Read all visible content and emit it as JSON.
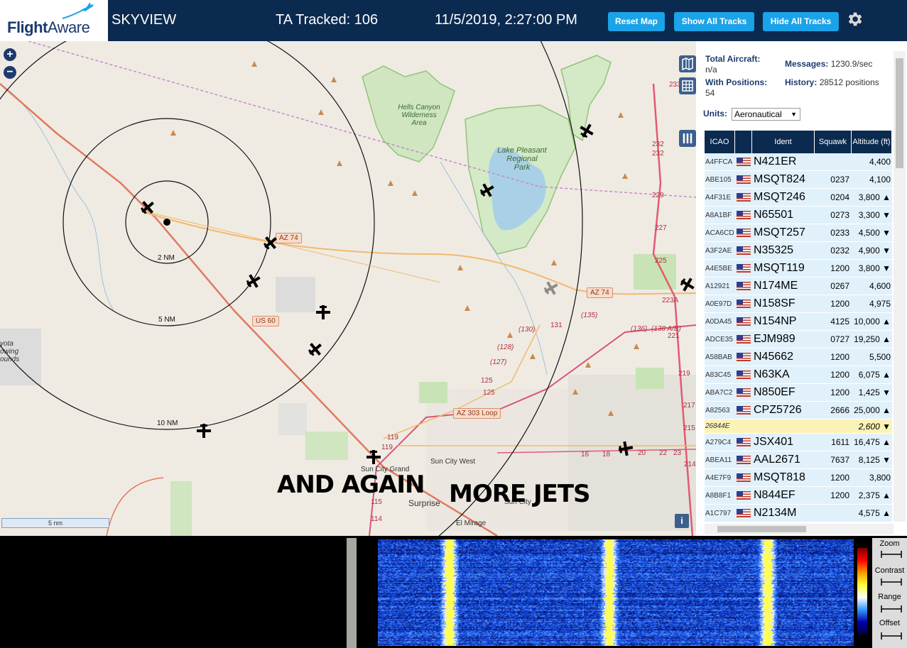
{
  "header": {
    "logo_text_bold": "Flight",
    "logo_text_light": "Aware",
    "app_name": "SKYVIEW",
    "tracked": "TA Tracked: 106",
    "datetime": "11/5/2019, 2:27:00 PM",
    "buttons": {
      "reset_map": "Reset Map",
      "show_all": "Show All Tracks",
      "hide_all": "Hide All Tracks"
    },
    "settings_icon": "gear-icon"
  },
  "map": {
    "zoom_in": "+",
    "zoom_out": "−",
    "scale": "5 nm",
    "info": "i",
    "rings": {
      "r2": "2 NM",
      "r5": "5 NM",
      "r10": "10 NM"
    },
    "places": {
      "hells_canyon": "Hells Canyon\nWilderness\nArea",
      "lake_pleasant": "Lake Pleasant\nRegional\nPark",
      "sun_city_grand": "Sun City Grand",
      "sun_city_west": "Sun City West",
      "surprise": "Surprise",
      "sun_city": "Sun City",
      "el_mirage": "El Mirage",
      "yota": "yota\nowing\nounds"
    },
    "shields": {
      "az74_a": "AZ 74",
      "az74_b": "AZ 74",
      "us60": "US 60",
      "az303": "AZ 303 Loop"
    },
    "road_numbers": {
      "n135": "(135)",
      "n136": "(136)",
      "n138": "(138 A/B)",
      "n130": "(130)",
      "n131": "131",
      "n128": "(128)",
      "n127": "(127)",
      "n125a": "125",
      "n125b": "125",
      "n119a": "119",
      "n119b": "119",
      "n115": "115",
      "n114": "114",
      "n16": "16",
      "n18": "18",
      "n20": "20",
      "n22": "22",
      "n23": "23",
      "n232a": "232",
      "n232b": "232",
      "n229": "229",
      "n227": "227",
      "n225": "225",
      "n223a": "223A",
      "n221": "221",
      "n219": "219",
      "n217": "217",
      "n215": "215",
      "n214": "214",
      "n233": "233"
    },
    "annotations": {
      "and_again": "AND AGAIN",
      "more_jets": "MORE JETS"
    },
    "map_layers_icon": "map-icon",
    "grid_icon": "grid-icon",
    "columns_icon": "columns-icon"
  },
  "panel": {
    "total_aircraft_label": "Total Aircraft:",
    "total_aircraft_value": "n/a",
    "messages_label": "Messages:",
    "messages_value": "1230.9/sec",
    "with_positions_label": "With Positions:",
    "with_positions_value": "54",
    "history_label": "History:",
    "history_value": "28512 positions",
    "units_label": "Units:",
    "units_value": "Aeronautical",
    "columns": {
      "icao": "ICAO",
      "ident": "Ident",
      "squawk": "Squawk",
      "altitude": "Altitude (ft)"
    },
    "rows": [
      {
        "icao": "A4FFCA",
        "ident": "N421ER",
        "squawk": "",
        "alt": "4,400"
      },
      {
        "icao": "ABE105",
        "ident": "MSQT824",
        "squawk": "0237",
        "alt": "4,100"
      },
      {
        "icao": "A4F31E",
        "ident": "MSQT246",
        "squawk": "0204",
        "alt": "3,800 ▲"
      },
      {
        "icao": "A8A1BF",
        "ident": "N65501",
        "squawk": "0273",
        "alt": "3,300 ▼"
      },
      {
        "icao": "ACA6CD",
        "ident": "MSQT257",
        "squawk": "0233",
        "alt": "4,500 ▼"
      },
      {
        "icao": "A3F2AE",
        "ident": "N35325",
        "squawk": "0232",
        "alt": "4,900 ▼"
      },
      {
        "icao": "A4E5BE",
        "ident": "MSQT119",
        "squawk": "1200",
        "alt": "3,800 ▼"
      },
      {
        "icao": "A12921",
        "ident": "N174ME",
        "squawk": "0267",
        "alt": "4,600"
      },
      {
        "icao": "A0E97D",
        "ident": "N158SF",
        "squawk": "1200",
        "alt": "4,975"
      },
      {
        "icao": "A0DA45",
        "ident": "N154NP",
        "squawk": "4125",
        "alt": "10,000 ▲"
      },
      {
        "icao": "ADCE35",
        "ident": "EJM989",
        "squawk": "0727",
        "alt": "19,250 ▲"
      },
      {
        "icao": "A58BAB",
        "ident": "N45662",
        "squawk": "1200",
        "alt": "5,500"
      },
      {
        "icao": "A83C45",
        "ident": "N63KA",
        "squawk": "1200",
        "alt": "6,075 ▲"
      },
      {
        "icao": "ABA7C2",
        "ident": "N850EF",
        "squawk": "1200",
        "alt": "1,425 ▼"
      },
      {
        "icao": "A82563",
        "ident": "CPZ5726",
        "squawk": "2666",
        "alt": "25,000 ▲"
      },
      {
        "icao": "26844E",
        "ident": "",
        "squawk": "",
        "alt": "2,600 ▼",
        "highlight": true
      },
      {
        "icao": "A279C4",
        "ident": "JSX401",
        "squawk": "1611",
        "alt": "16,475 ▲"
      },
      {
        "icao": "ABEA11",
        "ident": "AAL2671",
        "squawk": "7637",
        "alt": "8,125 ▼"
      },
      {
        "icao": "A4E7F9",
        "ident": "MSQT818",
        "squawk": "1200",
        "alt": "3,800"
      },
      {
        "icao": "A8B8F1",
        "ident": "N844EF",
        "squawk": "1200",
        "alt": "2,375 ▲"
      },
      {
        "icao": "A1C797",
        "ident": "N2134M",
        "squawk": "",
        "alt": "4,575 ▲"
      }
    ]
  },
  "spectrum": {
    "controls": {
      "zoom": "Zoom",
      "contrast": "Contrast",
      "range": "Range",
      "offset": "Offset"
    }
  },
  "colors": {
    "header_bg": "#0b2a4f",
    "button_bg": "#1aa3e8",
    "row_bg": "#e1f1fb",
    "row_highlight": "#fbf3b5",
    "map_bg": "#efebe3"
  }
}
